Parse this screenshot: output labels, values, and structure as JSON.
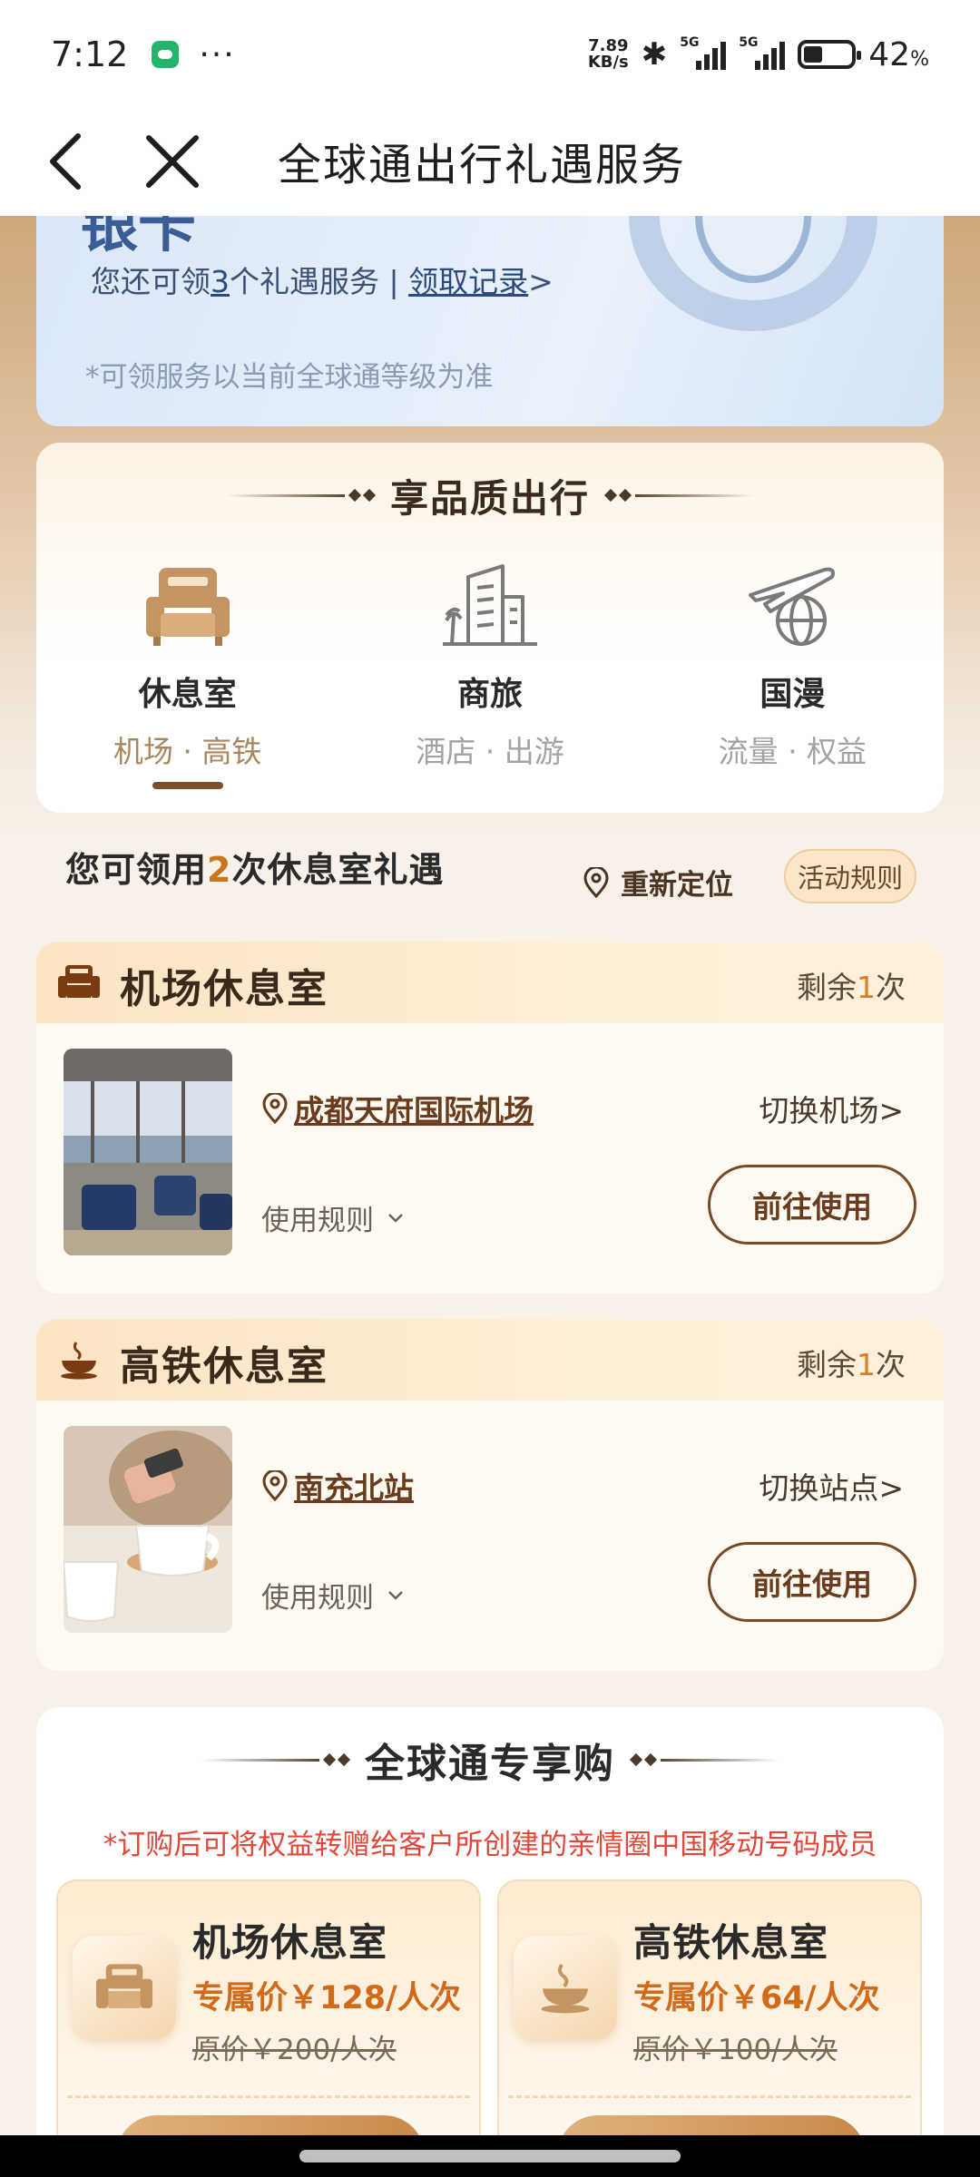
{
  "status_bar": {
    "time": "7:12",
    "more": "···",
    "net_speed_value": "7.89",
    "net_speed_unit": "KB/s",
    "signal_label_1": "5G",
    "signal_label_2": "5G",
    "battery_percent": "42",
    "battery_unit": "%"
  },
  "nav": {
    "title": "全球通出行礼遇服务"
  },
  "blue_card": {
    "partial_heading": "银卡",
    "remaining_prefix": "您还可领",
    "remaining_count": "3",
    "remaining_suffix": "个礼遇服务 | ",
    "records_link": "领取记录",
    "records_arrow": ">",
    "note": "*可领服务以当前全球通等级为准"
  },
  "quality": {
    "title": "享品质出行",
    "tabs": [
      {
        "name": "休息室",
        "sub": "机场 · 高铁",
        "icon": "armchair-icon",
        "active": true
      },
      {
        "name": "商旅",
        "sub": "酒店 · 出游",
        "icon": "city-building-icon",
        "active": false
      },
      {
        "name": "国漫",
        "sub": "流量 · 权益",
        "icon": "plane-globe-icon",
        "active": false
      }
    ]
  },
  "count_row": {
    "prefix": "您可领用",
    "count": "2",
    "suffix": "次休息室礼遇",
    "relocate": "重新定位",
    "rules": "活动规则"
  },
  "lounges": [
    {
      "title": "机场休息室",
      "remain_prefix": "剩余",
      "remain_count": "1",
      "remain_suffix": "次",
      "location": "成都天府国际机场",
      "switch": "切换机场>",
      "use_rules": "使用规则",
      "go": "前往使用",
      "icon": "armchair-icon"
    },
    {
      "title": "高铁休息室",
      "remain_prefix": "剩余",
      "remain_count": "1",
      "remain_suffix": "次",
      "location": "南充北站",
      "switch": "切换站点>",
      "use_rules": "使用规则",
      "go": "前往使用",
      "icon": "coffee-cup-icon"
    }
  ],
  "shop": {
    "title": "全球通专享购",
    "notice": "*订购后可将权益转赠给客户所创建的亲情圈中国移动号码成员",
    "products": [
      {
        "name": "机场休息室",
        "price": "专属价￥128/人次",
        "original": "原价￥200/人次",
        "icon": "armchair-icon"
      },
      {
        "name": "高铁休息室",
        "price": "专属价￥64/人次",
        "original": "原价￥100/人次",
        "icon": "coffee-cup-icon"
      }
    ]
  },
  "colors": {
    "accent_brown": "#6b3b1e",
    "orange_number": "#c9761e",
    "notice_red": "#e0483a"
  }
}
